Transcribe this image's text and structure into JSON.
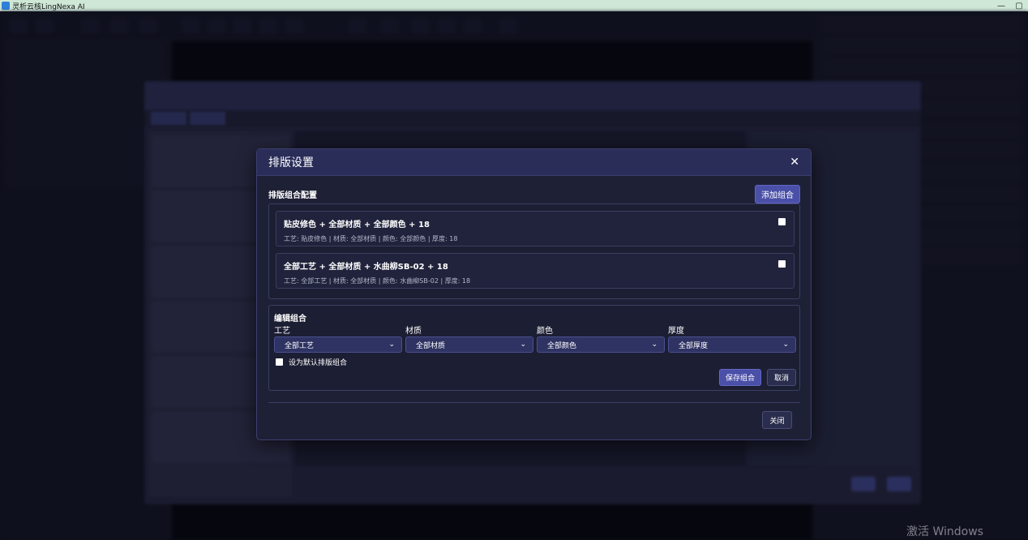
{
  "window": {
    "title": "灵析云核LingNexa AI",
    "minimize": "—",
    "maximize": "▢"
  },
  "modal": {
    "title": "排版设置",
    "close_glyph": "✕",
    "section_title": "排版组合配置",
    "add_button": "添加组合",
    "combinations": [
      {
        "name": "贴皮修色 + 全部材质 + 全部颜色 + 18",
        "desc": "工艺: 贴皮修色 | 材质: 全部材质 | 颜色: 全部颜色 | 厚度: 18"
      },
      {
        "name": "全部工艺 + 全部材质 + 水曲柳SB-02 + 18",
        "desc": "工艺: 全部工艺 | 材质: 全部材质 | 颜色: 水曲柳SB-02 | 厚度: 18"
      }
    ],
    "edit": {
      "title": "编辑组合",
      "fields": [
        {
          "label": "工艺",
          "value": "全部工艺"
        },
        {
          "label": "材质",
          "value": "全部材质"
        },
        {
          "label": "颜色",
          "value": "全部颜色"
        },
        {
          "label": "厚度",
          "value": "全部厚度"
        }
      ],
      "default_label": "设为默认排版组合",
      "save_button": "保存组合",
      "cancel_button": "取消"
    },
    "close_button": "关闭"
  },
  "watermark": "激活 Windows",
  "icons": {
    "app": "app-logo-icon",
    "close": "close-icon",
    "chevron": "chevron-down-icon",
    "checkbox": "checkbox-icon"
  },
  "colors": {
    "accent": "#4a4fa8",
    "header": "#2a2d58",
    "panel": "#1e2036",
    "titlebar": "#cfe7d6"
  }
}
